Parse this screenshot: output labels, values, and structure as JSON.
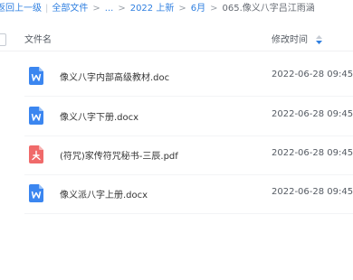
{
  "breadcrumb": {
    "back": "返回上一级",
    "all_files": "全部文件",
    "ellipsis": "...",
    "folder1": "2022 上新",
    "folder2": "6月",
    "current": "065.像义八字吕江雨涵"
  },
  "header": {
    "name_col": "文件名",
    "time_col": "修改时间"
  },
  "files": [
    {
      "name": "像义八字内部高级教材.doc",
      "modified": "2022-06-28 09:45",
      "type": "word",
      "icon": "word-file-icon"
    },
    {
      "name": "像义八字下册.docx",
      "modified": "2022-06-28 09:45",
      "type": "word",
      "icon": "word-file-icon"
    },
    {
      "name": "(符咒)家传符咒秘书-三辰.pdf",
      "modified": "2022-06-28 09:45",
      "type": "pdf",
      "icon": "pdf-file-icon"
    },
    {
      "name": "像义派八字上册.docx",
      "modified": "2022-06-28 09:45",
      "type": "word",
      "icon": "word-file-icon"
    }
  ],
  "colors": {
    "link": "#2f7fe0",
    "word": "#3b86f0",
    "pdf": "#f06a6a"
  }
}
